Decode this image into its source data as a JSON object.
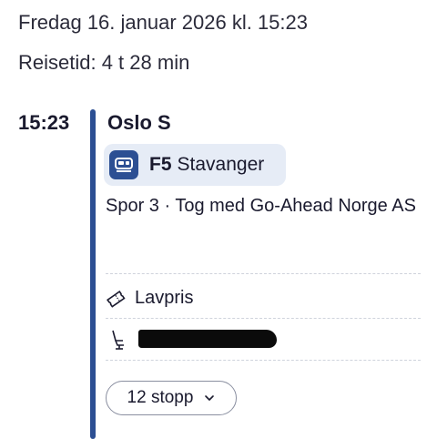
{
  "header": {
    "date_text": "Fredag 16. januar 2026 kl. 15:23",
    "travel_time_text": "Reisetid: 4 t 28 min"
  },
  "leg": {
    "departure_time": "15:23",
    "station": "Oslo S",
    "line": {
      "icon": "train-icon",
      "code": "F5",
      "destination": "Stavanger",
      "chip_color": "#e6ecf6",
      "icon_color": "#2c4f93"
    },
    "platform_info": "Spor 3 · Tog med Go-Ahead Norge AS",
    "ticket": {
      "icon": "ticket-icon",
      "label": "Lavpris"
    },
    "seat": {
      "icon": "seat-icon"
    },
    "stops_button": {
      "label": "12 stopp",
      "icon": "chevron-down-icon"
    },
    "timeline_color": "#2c4f93"
  }
}
